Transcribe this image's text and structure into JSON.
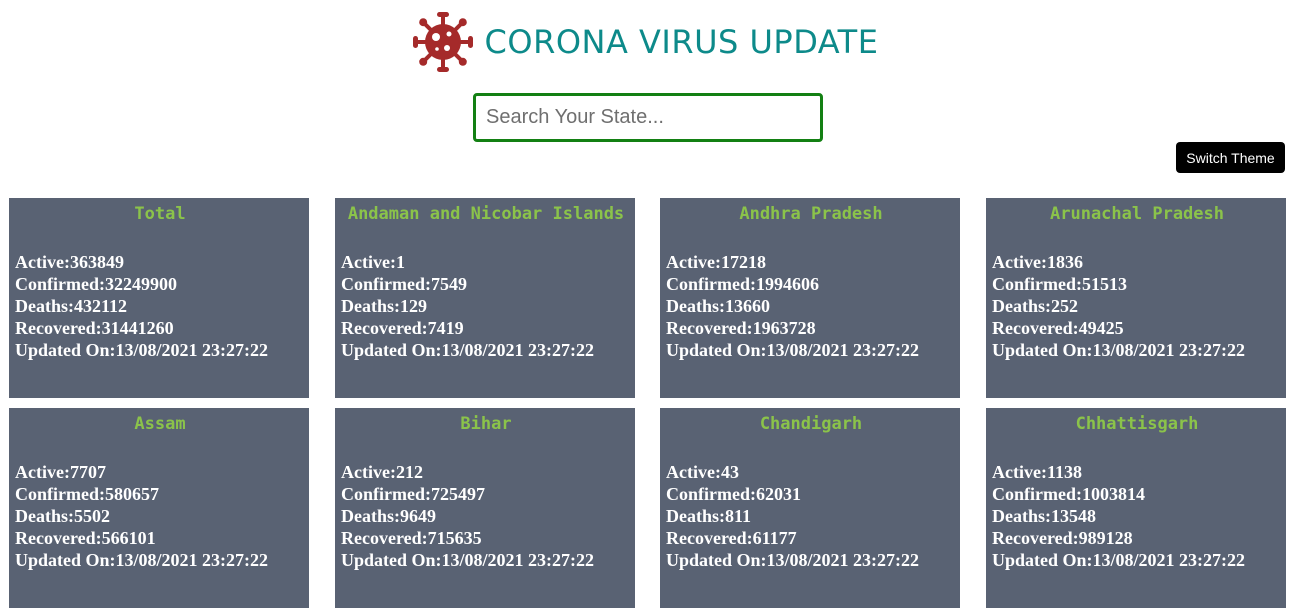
{
  "header": {
    "title": "CORONA VIRUS UPDATE",
    "logo_icon": "virus-icon",
    "logo_color": "#a52a2a",
    "title_color": "#0d8a8a"
  },
  "search": {
    "placeholder": "Search Your State...",
    "value": "",
    "border_color": "#138013"
  },
  "theme_button": {
    "label": "Switch Theme"
  },
  "labels": {
    "active": "Active:",
    "confirmed": "Confirmed:",
    "deaths": "Deaths:",
    "recovered": "Recovered:",
    "updated": "Updated On:"
  },
  "colors": {
    "card_bg": "#596273",
    "card_title": "#8bc34a",
    "card_text": "#ffffff"
  },
  "cards": [
    {
      "name": "Total",
      "active": "363849",
      "confirmed": "32249900",
      "deaths": "432112",
      "recovered": "31441260",
      "updated": "13/08/2021 23:27:22"
    },
    {
      "name": "Andaman and Nicobar Islands",
      "active": "1",
      "confirmed": "7549",
      "deaths": "129",
      "recovered": "7419",
      "updated": "13/08/2021 23:27:22"
    },
    {
      "name": "Andhra Pradesh",
      "active": "17218",
      "confirmed": "1994606",
      "deaths": "13660",
      "recovered": "1963728",
      "updated": "13/08/2021 23:27:22"
    },
    {
      "name": "Arunachal Pradesh",
      "active": "1836",
      "confirmed": "51513",
      "deaths": "252",
      "recovered": "49425",
      "updated": "13/08/2021 23:27:22"
    },
    {
      "name": "Assam",
      "active": "7707",
      "confirmed": "580657",
      "deaths": "5502",
      "recovered": "566101",
      "updated": "13/08/2021 23:27:22"
    },
    {
      "name": "Bihar",
      "active": "212",
      "confirmed": "725497",
      "deaths": "9649",
      "recovered": "715635",
      "updated": "13/08/2021 23:27:22"
    },
    {
      "name": "Chandigarh",
      "active": "43",
      "confirmed": "62031",
      "deaths": "811",
      "recovered": "61177",
      "updated": "13/08/2021 23:27:22"
    },
    {
      "name": "Chhattisgarh",
      "active": "1138",
      "confirmed": "1003814",
      "deaths": "13548",
      "recovered": "989128",
      "updated": "13/08/2021 23:27:22"
    }
  ]
}
